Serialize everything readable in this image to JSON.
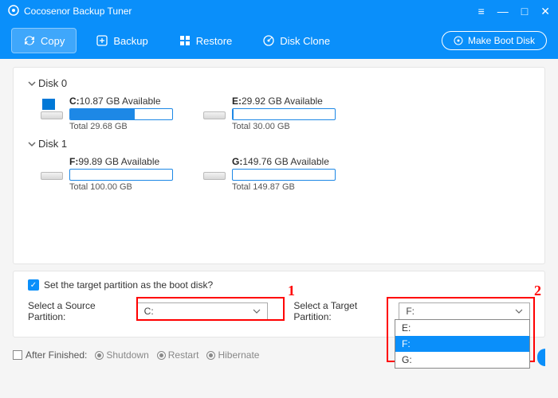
{
  "titlebar": {
    "title": "Cocosenor Backup Tuner"
  },
  "toolbar": {
    "copy": "Copy",
    "backup": "Backup",
    "restore": "Restore",
    "disk_clone": "Disk Clone",
    "make_boot": "Make Boot Disk"
  },
  "disks": [
    {
      "label": "Disk 0",
      "partitions": [
        {
          "letter": "C:",
          "avail": "10.87 GB Available",
          "total": "Total 29.68 GB",
          "fill_pct": 63,
          "is_windows": true
        },
        {
          "letter": "E:",
          "avail": "29.92 GB Available",
          "total": "Total 30.00 GB",
          "fill_pct": 1,
          "is_windows": false
        }
      ]
    },
    {
      "label": "Disk 1",
      "partitions": [
        {
          "letter": "F:",
          "avail": "99.89 GB Available",
          "total": "Total 100.00 GB",
          "fill_pct": 0,
          "is_windows": false
        },
        {
          "letter": "G:",
          "avail": "149.76 GB Available",
          "total": "Total 149.87 GB",
          "fill_pct": 0,
          "is_windows": false
        }
      ]
    }
  ],
  "options": {
    "set_boot_label": "Set the target partition as the boot disk?",
    "source_label": "Select a Source Partition:",
    "source_value": "C:",
    "target_label": "Select a Target Partition:",
    "target_value": "F:",
    "target_options": [
      "E:",
      "F:",
      "G:"
    ]
  },
  "footer": {
    "after_finished": "After Finished:",
    "shutdown": "Shutdown",
    "restart": "Restart",
    "hibernate": "Hibernate"
  },
  "annotations": {
    "num1": "1",
    "num2": "2"
  }
}
